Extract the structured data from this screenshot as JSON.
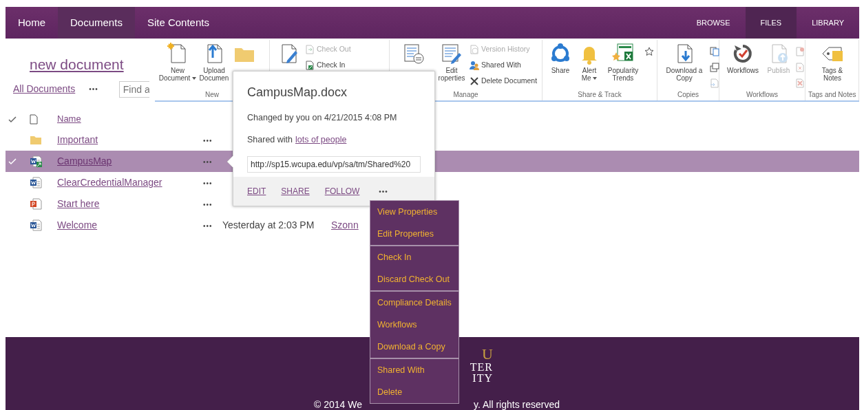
{
  "top_nav": {
    "tabs": [
      {
        "label": "Home",
        "selected": false
      },
      {
        "label": "Documents",
        "selected": true
      },
      {
        "label": "Site Contents",
        "selected": false
      }
    ],
    "ribbon_tabs": [
      {
        "label": "BROWSE",
        "selected": false
      },
      {
        "label": "FILES",
        "selected": true
      },
      {
        "label": "LIBRARY",
        "selected": false
      }
    ]
  },
  "page": {
    "new_document": "new document",
    "view": "All Documents",
    "view_menu": "•••",
    "search": {
      "placeholder": "Find a"
    }
  },
  "ribbon": {
    "groups": [
      {
        "label": "New",
        "items": [
          {
            "kind": "large",
            "lines": [
              "New",
              "Document"
            ],
            "caret": true,
            "disabled": false
          },
          {
            "kind": "large",
            "lines": [
              "Upload",
              "Documen"
            ],
            "caret": false,
            "disabled": false
          },
          {
            "kind": "large",
            "caret": false,
            "disabled": false
          }
        ]
      },
      {
        "items": [
          {
            "kind": "large",
            "caret": false,
            "disabled": false
          },
          {
            "kind": "smallstack",
            "entries": [
              {
                "label": "Check Out",
                "disabled": true
              },
              {
                "label": "Check In",
                "disabled": false
              }
            ]
          }
        ]
      },
      {
        "label": "Manage",
        "items": [
          {
            "kind": "large",
            "caret": false,
            "disabled": false
          },
          {
            "kind": "large",
            "lines": [
              "Edit",
              "roperties"
            ],
            "caret": false,
            "disabled": false
          },
          {
            "kind": "smallstack",
            "entries": [
              {
                "label": "Version History",
                "disabled": true
              },
              {
                "label": "Shared With",
                "disabled": false
              },
              {
                "label": "Delete Document",
                "disabled": false
              }
            ]
          }
        ]
      },
      {
        "label": "Share & Track",
        "items": [
          {
            "kind": "large",
            "lines": [
              "Share"
            ],
            "caret": false,
            "disabled": false
          },
          {
            "kind": "large",
            "lines": [
              "Alert",
              "Me"
            ],
            "caret": true,
            "disabled": false
          },
          {
            "kind": "large",
            "lines": [
              "Popularity",
              "Trends"
            ],
            "caret": false,
            "disabled": false
          },
          {
            "kind": "iconstack",
            "entries": [
              {
                "disabled": false
              }
            ]
          }
        ]
      },
      {
        "label": "Copies",
        "items": [
          {
            "kind": "large",
            "lines": [
              "Download a",
              "Copy"
            ],
            "caret": false,
            "disabled": false
          },
          {
            "kind": "iconstack",
            "entries": [
              {
                "disabled": false
              },
              {
                "disabled": false
              },
              {
                "disabled": true
              }
            ]
          }
        ]
      },
      {
        "label": "Workflows",
        "items": [
          {
            "kind": "large",
            "lines": [
              "Workflows"
            ],
            "caret": false,
            "disabled": false
          },
          {
            "kind": "large",
            "lines": [
              "Publish"
            ],
            "caret": false,
            "disabled": true
          },
          {
            "kind": "iconstack",
            "entries": [
              {
                "disabled": true
              },
              {
                "disabled": true
              },
              {
                "disabled": true
              }
            ]
          }
        ]
      },
      {
        "label": "Tags and Notes",
        "items": [
          {
            "kind": "large",
            "lines": [
              "Tags &",
              "Notes"
            ],
            "caret": false,
            "disabled": false
          }
        ]
      }
    ]
  },
  "list": {
    "columns": [
      {
        "label": "Name"
      }
    ],
    "rows": [
      {
        "kind": "folder",
        "name": "Important",
        "checked_out": false,
        "selected": false,
        "menu": "•••"
      },
      {
        "kind": "word",
        "name": "CampusMap",
        "checked_out": true,
        "selected": true,
        "menu": "•••"
      },
      {
        "kind": "word",
        "name": "ClearCredentialManager",
        "checked_out": false,
        "selected": false,
        "menu": "•••"
      },
      {
        "kind": "powerpoint",
        "name": "Start here",
        "checked_out": false,
        "selected": false,
        "menu": "•••"
      },
      {
        "kind": "word",
        "name": "Welcome",
        "checked_out": false,
        "selected": false,
        "menu": "•••",
        "modified": "Yesterday at 2:03 PM",
        "modified_by": "Szonn"
      }
    ]
  },
  "callout": {
    "title": "CampusMap.docx",
    "changed": "Changed by you on 4/21/2015 4:08 PM",
    "shared_prefix": "Shared with",
    "shared_link": "lots of people",
    "url": "http://sp15.wcupa.edu/vp/sa/tm/Shared%20",
    "actions": [
      "EDIT",
      "SHARE",
      "FOLLOW"
    ],
    "more": "•••"
  },
  "menu": {
    "groups": [
      [
        "View Properties",
        "Edit Properties"
      ],
      [
        "Check In",
        "Discard Check Out"
      ],
      [
        "Compliance Details",
        "Workflows",
        "Download a Copy"
      ],
      [
        "Shared With",
        "Delete"
      ]
    ]
  },
  "footer": {
    "logo_lines": [
      "U",
      "TER",
      "ITY"
    ],
    "copyright_left": "© 2014 We",
    "copyright_right": "y. All rights reserved"
  }
}
